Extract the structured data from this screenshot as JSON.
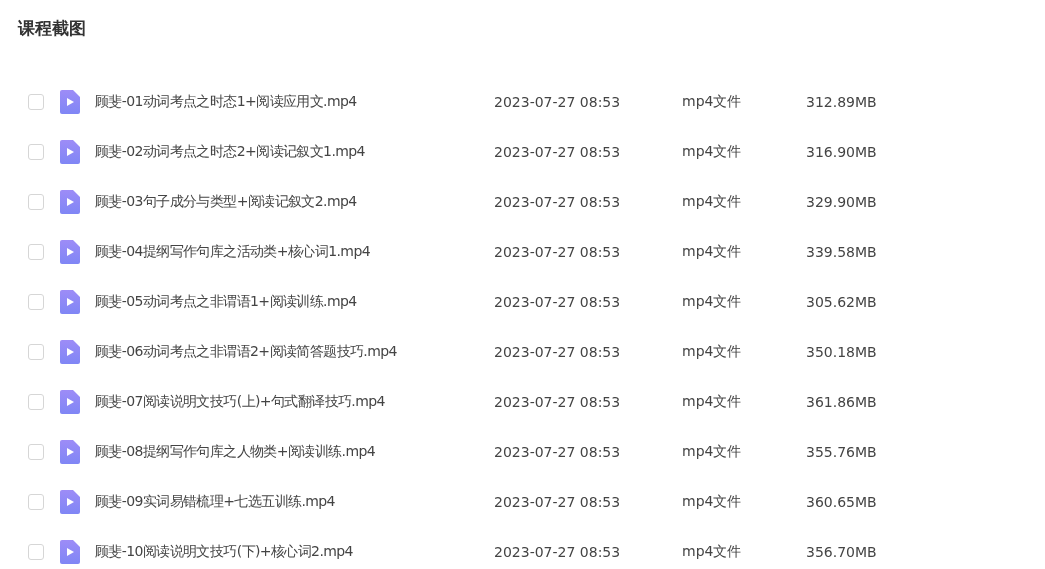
{
  "title": "课程截图",
  "files": [
    {
      "name": "顾斐-01动词考点之时态1+阅读应用文.mp4",
      "date": "2023-07-27 08:53",
      "type": "mp4文件",
      "size": "312.89MB",
      "checked": false
    },
    {
      "name": "顾斐-02动词考点之时态2+阅读记叙文1.mp4",
      "date": "2023-07-27 08:53",
      "type": "mp4文件",
      "size": "316.90MB",
      "checked": false
    },
    {
      "name": "顾斐-03句子成分与类型+阅读记叙文2.mp4",
      "date": "2023-07-27 08:53",
      "type": "mp4文件",
      "size": "329.90MB",
      "checked": false
    },
    {
      "name": "顾斐-04提纲写作句库之活动类+核心词1.mp4",
      "date": "2023-07-27 08:53",
      "type": "mp4文件",
      "size": "339.58MB",
      "checked": false
    },
    {
      "name": "顾斐-05动词考点之非谓语1+阅读训练.mp4",
      "date": "2023-07-27 08:53",
      "type": "mp4文件",
      "size": "305.62MB",
      "checked": false
    },
    {
      "name": "顾斐-06动词考点之非谓语2+阅读简答题技巧.mp4",
      "date": "2023-07-27 08:53",
      "type": "mp4文件",
      "size": "350.18MB",
      "checked": false
    },
    {
      "name": "顾斐-07阅读说明文技巧(上)+句式翻译技巧.mp4",
      "date": "2023-07-27 08:53",
      "type": "mp4文件",
      "size": "361.86MB",
      "checked": false
    },
    {
      "name": "顾斐-08提纲写作句库之人物类+阅读训练.mp4",
      "date": "2023-07-27 08:53",
      "type": "mp4文件",
      "size": "355.76MB",
      "checked": false
    },
    {
      "name": "顾斐-09实词易错梳理+七选五训练.mp4",
      "date": "2023-07-27 08:53",
      "type": "mp4文件",
      "size": "360.65MB",
      "checked": false
    },
    {
      "name": "顾斐-10阅读说明文技巧(下)+核心词2.mp4",
      "date": "2023-07-27 08:53",
      "type": "mp4文件",
      "size": "356.70MB",
      "checked": false
    }
  ]
}
